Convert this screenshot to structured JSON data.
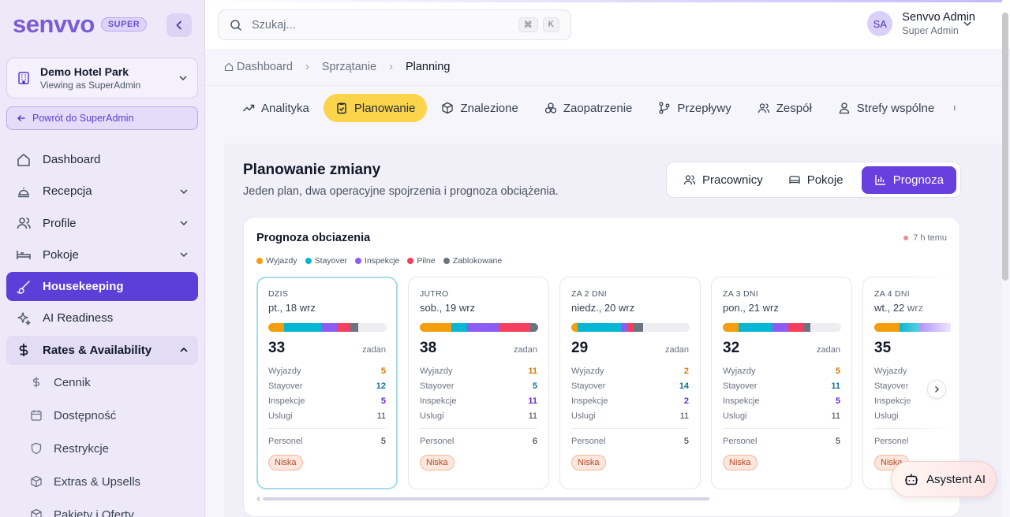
{
  "brand": {
    "logo": "senvvo",
    "badge": "SUPER"
  },
  "hotel": {
    "name": "Demo Hotel Park",
    "subtitle": "Viewing as SuperAdmin"
  },
  "back_label": "Powrót do SuperAdmin",
  "nav": {
    "dashboard": "Dashboard",
    "recepcja": "Recepcja",
    "profile": "Profile",
    "pokoje": "Pokoje",
    "housekeeping": "Housekeeping",
    "ai_readiness": "AI Readiness",
    "rates": "Rates & Availability",
    "sub": {
      "cennik": "Cennik",
      "dostepnosc": "Dostępność",
      "restrykcje": "Restrykcje",
      "extras": "Extras & Upsells",
      "pakiety": "Pakiety i Oferty"
    }
  },
  "search": {
    "placeholder": "Szukaj...",
    "key1": "⌘",
    "key2": "K"
  },
  "user": {
    "initials": "SA",
    "name": "Senvvo Admin",
    "role": "Super Admin"
  },
  "breadcrumb": {
    "home": "Dashboard",
    "section": "Sprzątanie",
    "current": "Planning"
  },
  "tabs": {
    "analityka": "Analityka",
    "planowanie": "Planowanie",
    "znalezione": "Znalezione",
    "zaopatrzenie": "Zaopatrzenie",
    "przeplywy": "Przepływy",
    "zespol": "Zespół",
    "strefy": "Strefy wspólne"
  },
  "panel": {
    "title": "Planowanie zmiany",
    "subtitle": "Jeden plan, dwa operacyjne spojrzenia i prognoza obciążenia.",
    "views": {
      "pracownicy": "Pracownicy",
      "pokoje": "Pokoje",
      "prognoza": "Prognoza"
    }
  },
  "forecast": {
    "title": "Prognoza obciazenia",
    "updated": "7 h temu",
    "legend": {
      "wyjazdy": "Wyjazdy",
      "stayover": "Stayover",
      "inspekcje": "Inspekcje",
      "pilne": "Pilne",
      "zablokowane": "Zablokowane"
    },
    "colors": {
      "wyjazdy": "#f59e0b",
      "stayover": "#06b6d4",
      "inspekcje": "#8b5cf6",
      "pilne": "#f43f5e",
      "zablokowane": "#6b7280"
    },
    "unit": "zadan",
    "labels": {
      "wyjazdy": "Wyjazdy",
      "stayover": "Stayover",
      "inspekcje": "Inspekcje",
      "uslugi": "Uslugi",
      "personel": "Personel"
    },
    "days": [
      {
        "label": "DZIS",
        "date": "pt., 18 wrz",
        "total": "33",
        "wyjazdy": "5",
        "stayover": "12",
        "inspekcje": "5",
        "uslugi": "11",
        "personel": "5",
        "load": "Niska"
      },
      {
        "label": "JUTRO",
        "date": "sob., 19 wrz",
        "total": "38",
        "wyjazdy": "11",
        "stayover": "5",
        "inspekcje": "11",
        "uslugi": "11",
        "personel": "6",
        "load": "Niska"
      },
      {
        "label": "ZA 2 DNI",
        "date": "niedz., 20 wrz",
        "total": "29",
        "wyjazdy": "2",
        "stayover": "14",
        "inspekcje": "2",
        "uslugi": "11",
        "personel": "5",
        "load": "Niska"
      },
      {
        "label": "ZA 3 DNI",
        "date": "pon., 21 wrz",
        "total": "32",
        "wyjazdy": "5",
        "stayover": "11",
        "inspekcje": "5",
        "uslugi": "11",
        "personel": "5",
        "load": "Niska"
      },
      {
        "label": "ZA 4 DNI",
        "date": "wt., 22 wrz",
        "total": "35",
        "wyjazdy": "",
        "stayover": "",
        "inspekcje": "",
        "uslugi": "",
        "personel": "",
        "load": "Niska"
      }
    ]
  },
  "assistant": "Asystent AI"
}
